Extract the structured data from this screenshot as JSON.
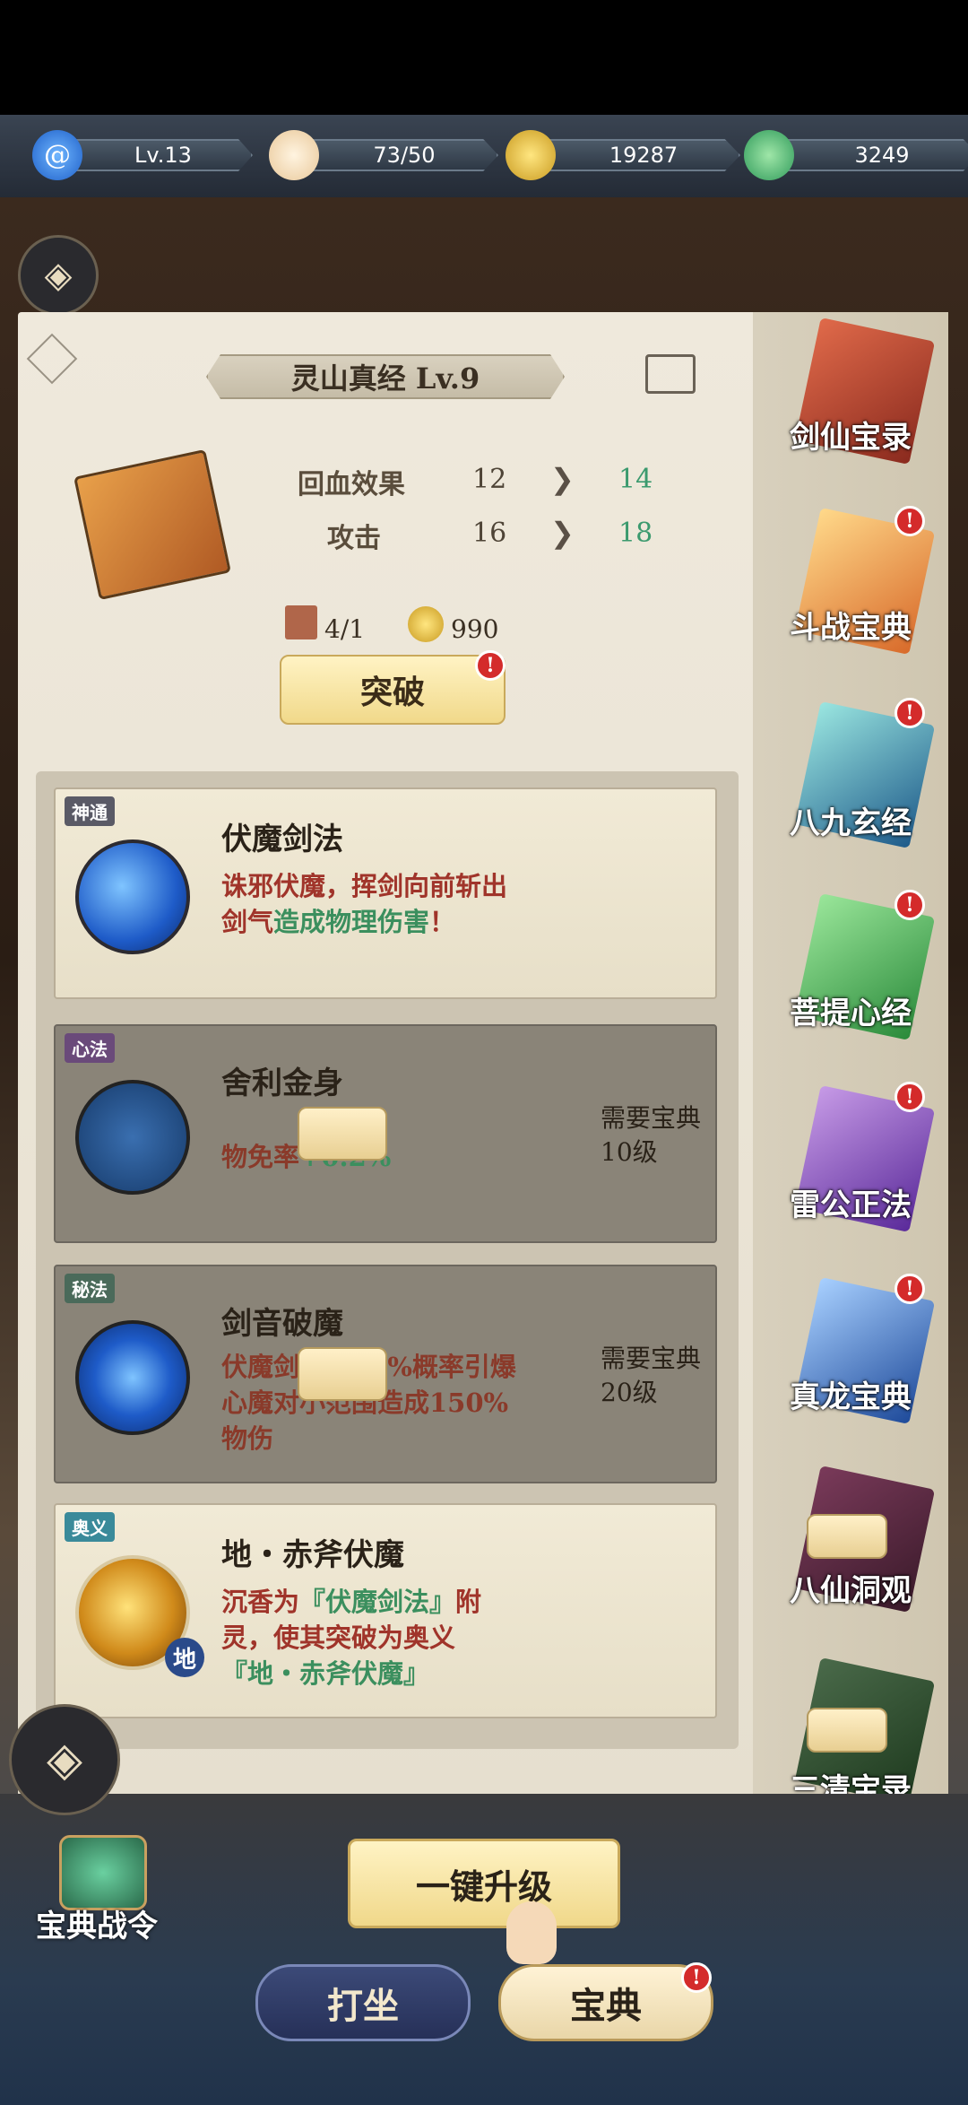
{
  "resources": [
    {
      "icon": "swirl-icon",
      "value": "Lv.13"
    },
    {
      "icon": "bun-icon",
      "value": "73/50"
    },
    {
      "icon": "coin-icon",
      "value": "19287"
    },
    {
      "icon": "jade-leaf-icon",
      "value": "3249"
    }
  ],
  "book": {
    "title": "灵山真经 Lv.9",
    "stats": [
      {
        "label": "回血效果",
        "current": "12",
        "next": "14"
      },
      {
        "label": "攻击",
        "current": "16",
        "next": "18"
      }
    ],
    "cost_pages": "4/1",
    "cost_coins": "990",
    "break_label": "突破",
    "badge": "!"
  },
  "skills": [
    {
      "tag": "神通",
      "name": "伏魔剑法",
      "desc_red": "诛邪伏魔，挥剑向前斩出剑气",
      "desc_green": "造成物理伤害",
      "desc_tail": "！",
      "locked": false
    },
    {
      "tag": "心法",
      "name": "舍利金身",
      "desc_red": "物免率",
      "desc_green": "+0.2%",
      "locked": true,
      "req": "需要宝典",
      "req_level": "10级"
    },
    {
      "tag": "秘法",
      "name": "剑音破魔",
      "desc_red": "伏魔剑法有10%概率引爆心魔对小范围造成150%物伤",
      "locked": true,
      "req": "需要宝典",
      "req_level": "20级"
    },
    {
      "tag": "奥义",
      "name": "地・赤斧伏魔",
      "desc_red": "沉香为",
      "desc_q1": "『伏魔剑法』",
      "desc_mid": "附灵，使其突破为奥义",
      "desc_q2": "『地・赤斧伏魔』",
      "orb_label": "地",
      "locked": false
    }
  ],
  "sidebar_books": [
    {
      "name": "剑仙宝录",
      "badge": false,
      "locked": false
    },
    {
      "name": "斗战宝典",
      "badge": true,
      "locked": false
    },
    {
      "name": "八九玄经",
      "badge": true,
      "locked": false
    },
    {
      "name": "菩提心经",
      "badge": true,
      "locked": false
    },
    {
      "name": "雷公正法",
      "badge": true,
      "locked": false
    },
    {
      "name": "真龙宝典",
      "badge": true,
      "locked": false
    },
    {
      "name": "八仙洞观",
      "badge": false,
      "locked": true
    },
    {
      "name": "三清宝录",
      "badge": false,
      "locked": true
    }
  ],
  "bottom": {
    "battlepass_label": "宝典战令",
    "onekey_label": "一键升级",
    "tab_meditate": "打坐",
    "tab_codex": "宝典"
  },
  "colors": {
    "accent_green": "#3b9a6e",
    "desc_red": "#a0342a",
    "badge_red": "#d42b2b"
  }
}
